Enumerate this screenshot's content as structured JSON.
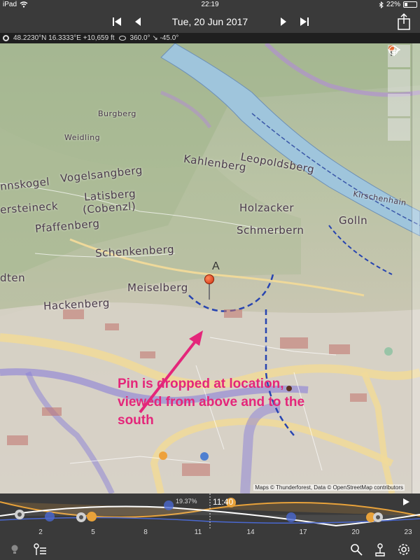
{
  "status_bar": {
    "carrier": "iPad",
    "time": "22:19",
    "battery": "22%"
  },
  "nav": {
    "date": "Tue, 20 Jun 2017",
    "icons": [
      "skip-first-icon",
      "step-back-icon",
      "step-forward-icon",
      "skip-last-icon",
      "share-icon"
    ]
  },
  "info_bar": {
    "coordinates": "48.2230°N 16.3333°E +10,659 ft",
    "view": "360.0° ↘ -45.0°"
  },
  "map": {
    "labels": {
      "kahlenberg": "Kahlenberg",
      "leopoldsberg": "Leopoldsberg",
      "holzacker": "Holzacker",
      "golln": "Golln",
      "schmerbern": "Schmerbern",
      "kirschenhain": "Kirschenhain",
      "vogelsangberg": "Vogelsangberg",
      "hermannskogel": "nnskogel",
      "latisberg": "Latisberg",
      "cobenzl": "(Cobenzl)",
      "reisenberg": "ersteineck",
      "pfaffenberg": "Pfaffenberg",
      "schenkenberg": "Schenkenberg",
      "meiselberg": "Meiselberg",
      "hackenberg": "Hackenberg",
      "dten": "dten",
      "burgberg": "Burgberg",
      "weidling": "Weidling"
    },
    "pin_label": "A",
    "annotation": "Pin is dropped at location, viewed from above and to the south",
    "attribution": "Maps © Thunderforest, Data © OpenStreetMap contributors",
    "accent_color": "#e4267a"
  },
  "timeline": {
    "percent": "19.37%",
    "time": "11:40",
    "ticks": [
      "2",
      "5",
      "8",
      "11",
      "14",
      "17",
      "20",
      "23"
    ]
  },
  "toolbar": {
    "icons": [
      "lightbulb-icon",
      "pin-list-icon",
      "search-icon",
      "pin-tool-icon",
      "gear-icon"
    ]
  }
}
